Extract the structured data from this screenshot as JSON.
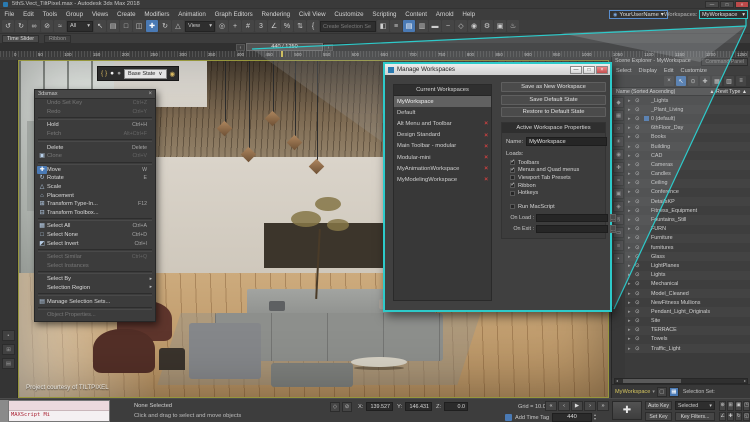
{
  "window": {
    "title": "5thS.Vect_TiltPixel.max  - Autodesk 3ds Max 2018",
    "minimize_glyph": "—",
    "maximize_glyph": "□",
    "close_glyph": "×"
  },
  "menubar": {
    "items": [
      "File",
      "Edit",
      "Tools",
      "Group",
      "Views",
      "Create",
      "Modifiers",
      "Animation",
      "Graph Editors",
      "Rendering",
      "Civil View",
      "Customize",
      "Scripting",
      "Content",
      "Arnold",
      "Help"
    ],
    "username": "YourUserName",
    "username_arrow": "▾",
    "workspaces_label": "Workspaces:",
    "workspace_value": "MyWorkspace",
    "workspace_arrow": "▾"
  },
  "toolbar": {
    "group1": [
      {
        "name": "undo-icon",
        "glyph": "↺"
      },
      {
        "name": "redo-icon",
        "glyph": "↻"
      },
      {
        "name": "select-link-icon",
        "glyph": "∞"
      },
      {
        "name": "unlink-icon",
        "glyph": "⊘"
      },
      {
        "name": "bind-spacewarp-icon",
        "glyph": "≈"
      }
    ],
    "filter_dropdown": "All",
    "group2": [
      {
        "name": "select-object-icon",
        "glyph": "↖"
      },
      {
        "name": "select-by-name-icon",
        "glyph": "▤"
      },
      {
        "name": "selection-region-icon",
        "glyph": "□"
      },
      {
        "name": "window-crossing-icon",
        "glyph": "◫"
      },
      {
        "name": "move-icon",
        "glyph": "✚",
        "active": true
      },
      {
        "name": "rotate-icon",
        "glyph": "↻"
      },
      {
        "name": "scale-icon",
        "glyph": "△"
      }
    ],
    "coord_dropdown": "View",
    "group3": [
      {
        "name": "pivot-center-icon",
        "glyph": "◎"
      },
      {
        "name": "select-manipulate-icon",
        "glyph": "+"
      },
      {
        "name": "keyboard-override-icon",
        "glyph": "#"
      },
      {
        "name": "snaps-toggle-icon",
        "glyph": "3"
      },
      {
        "name": "angle-snap-icon",
        "glyph": "∠"
      },
      {
        "name": "percent-snap-icon",
        "glyph": "%"
      },
      {
        "name": "spinner-snap-icon",
        "glyph": "⇅"
      },
      {
        "name": "edit-named-selections-icon",
        "glyph": "{"
      }
    ],
    "create_selection_label": "Create Selection Se",
    "group4": [
      {
        "name": "mirror-icon",
        "glyph": "◧"
      },
      {
        "name": "layer-manager-icon",
        "glyph": "≡"
      },
      {
        "name": "scene-explorer-toggle-icon",
        "glyph": "▤",
        "active": true
      },
      {
        "name": "layer-explorer-icon",
        "glyph": "▥"
      },
      {
        "name": "ribbon-toggle-icon",
        "glyph": "▬"
      },
      {
        "name": "curve-editor-icon",
        "glyph": "~"
      },
      {
        "name": "schematic-view-icon",
        "glyph": "◇"
      },
      {
        "name": "material-editor-icon",
        "glyph": "◉"
      },
      {
        "name": "render-setup-icon",
        "glyph": "⚙"
      },
      {
        "name": "rendered-frame-icon",
        "glyph": "▣"
      },
      {
        "name": "render-production-icon",
        "glyph": "♨"
      }
    ],
    "dropdown_arrow": "▾"
  },
  "timeline": {
    "tab_time_slider": "Time Slider",
    "tab_ribbon": "Ribbon",
    "frame_display": "440 / 1250",
    "prev_arrow": "‹",
    "next_arrow": "›",
    "ruler_labels": [
      "0",
      "50",
      "100",
      "150",
      "200",
      "250",
      "300",
      "350",
      "400",
      "450",
      "500",
      "550",
      "600",
      "650",
      "700",
      "750",
      "800",
      "850",
      "900",
      "950",
      "1000",
      "1050",
      "1100",
      "1150",
      "1200",
      "1250"
    ]
  },
  "viewport": {
    "watermark": "Project courtesy of TILTPIXEL",
    "state_toolbar": {
      "brace_glyph": "{ }",
      "sphere_a_glyph": "●",
      "sphere_b_glyph": "●",
      "dropdown_value": "Base State",
      "dropdown_arrow": "∨",
      "camera_glyph": "◉"
    }
  },
  "quad_menu": {
    "title": "3dsmax",
    "close_glyph": "×",
    "items": [
      {
        "label": "Undo Set Key",
        "shortcut": "Ctrl+Z",
        "disabled": true
      },
      {
        "label": "Redo",
        "shortcut": "Ctrl+Y",
        "disabled": true
      },
      {
        "sep": true
      },
      {
        "label": "Hold",
        "shortcut": "Ctrl+H"
      },
      {
        "label": "Fetch",
        "shortcut": "Alt+Ctrl+F",
        "disabled": true
      },
      {
        "sep": true
      },
      {
        "label": "Delete",
        "shortcut": "Delete"
      },
      {
        "label": "Clone",
        "shortcut": "Ctrl+V",
        "disabled": true,
        "icon": "▣"
      },
      {
        "sep": true
      },
      {
        "label": "Move",
        "shortcut": "W",
        "icon": "✚",
        "icon_active": true
      },
      {
        "label": "Rotate",
        "shortcut": "E",
        "icon": "↻"
      },
      {
        "label": "Scale",
        "icon": "△"
      },
      {
        "label": "Placement",
        "icon": "⌂"
      },
      {
        "label": "Transform Type-In...",
        "shortcut": "F12",
        "icon": "⊞"
      },
      {
        "label": "Transform Toolbox...",
        "icon": "⊟"
      },
      {
        "sep": true
      },
      {
        "label": "Select All",
        "shortcut": "Ctrl+A",
        "icon": "▦"
      },
      {
        "label": "Select None",
        "shortcut": "Ctrl+D",
        "icon": "□"
      },
      {
        "label": "Select Invert",
        "shortcut": "Ctrl+I",
        "icon": "◩"
      },
      {
        "sep": true
      },
      {
        "label": "Select Similar",
        "shortcut": "Ctrl+Q",
        "disabled": true
      },
      {
        "label": "Select Instances",
        "disabled": true
      },
      {
        "sep": true
      },
      {
        "label": "Select By",
        "submenu": true
      },
      {
        "label": "Selection Region",
        "submenu": true
      },
      {
        "sep": true
      },
      {
        "label": "Manage Selection Sets...",
        "icon": "▤"
      },
      {
        "sep": true
      },
      {
        "label": "Object Properties...",
        "disabled": true
      }
    ]
  },
  "dialog": {
    "title": "Manage Workspaces",
    "minimize_glyph": "—",
    "maximize_glyph": "□",
    "close_glyph": "×",
    "list_header": "Current Workspaces",
    "delete_glyph": "×",
    "workspaces": [
      {
        "label": "MyWorkspace",
        "selected": true
      },
      {
        "label": "Default"
      },
      {
        "label": "Alt Menu and Toolbar",
        "deletable": true
      },
      {
        "label": "Design Standard",
        "deletable": true
      },
      {
        "label": "Main Toolbar - modular",
        "deletable": true
      },
      {
        "label": "Modular-mini",
        "deletable": true
      },
      {
        "label": "MyAnimationWorkspace",
        "deletable": true
      },
      {
        "label": "MyModelingWorkspace",
        "deletable": true
      }
    ],
    "buttons": [
      "Save as New Workspace",
      "Save Default State",
      "Restore to Default State"
    ],
    "properties_header": "Active Workspace Properties",
    "name_label": "Name:",
    "name_value": "MyWorkspace",
    "loads_label": "Loads:",
    "load_options": [
      {
        "label": "Toolbars",
        "checked": true
      },
      {
        "label": "Menus and Quad menus",
        "checked": true
      },
      {
        "label": "Viewport Tab Presets"
      },
      {
        "label": "Ribbon",
        "checked": true
      },
      {
        "label": "Hotkeys"
      }
    ],
    "macro_label": "Run MacScript",
    "on_load_label": "On Load :",
    "on_exit_label": "On Exit :",
    "browse_button": "..."
  },
  "scene_explorer": {
    "title": "Scene Explorer - MyWorkspace",
    "command_panel_tab": "Command Panel",
    "menus": [
      "Select",
      "Display",
      "Edit",
      "Customize"
    ],
    "toolbar_icons": [
      {
        "name": "delete-icon",
        "glyph": "×"
      },
      {
        "name": "pick-icon",
        "glyph": "↖",
        "active": true
      },
      {
        "name": "lock-icon",
        "glyph": "⊙"
      },
      {
        "name": "add-icon",
        "glyph": "✚"
      },
      {
        "name": "properties-icon",
        "glyph": "▦"
      },
      {
        "name": "columns-icon",
        "glyph": "▥"
      },
      {
        "name": "settings-icon",
        "glyph": "≡"
      }
    ],
    "name_header": "Name (Sorted Ascending)",
    "sort_glyph": "▲",
    "type_header": "▲ Revit Type ▲",
    "arrow_glyph": "▸",
    "eye_glyph": "⊙",
    "side_icons": [
      {
        "name": "display-all-icon",
        "glyph": "◆"
      },
      {
        "name": "geometry-icon",
        "glyph": "▦"
      },
      {
        "name": "shapes-icon",
        "glyph": "○"
      },
      {
        "name": "lights-icon",
        "glyph": "☀"
      },
      {
        "name": "cameras-icon",
        "glyph": "◉"
      },
      {
        "name": "helpers-icon",
        "glyph": "✚"
      },
      {
        "name": "spacewarps-icon",
        "glyph": "≈"
      },
      {
        "name": "groups-icon",
        "glyph": "▣"
      },
      {
        "name": "xref-icon",
        "glyph": "◈"
      },
      {
        "name": "bones-icon",
        "glyph": "§"
      },
      {
        "name": "containers-icon",
        "glyph": "▭"
      },
      {
        "name": "materials-icon",
        "glyph": "≡"
      },
      {
        "name": "filter-icon",
        "glyph": "▪"
      }
    ],
    "rows": [
      {
        "label": "_Lights"
      },
      {
        "label": "_Plant_Living"
      },
      {
        "label": "0 (default)",
        "tag": true
      },
      {
        "label": "6thFloor_Day"
      },
      {
        "label": "Books"
      },
      {
        "label": "Building"
      },
      {
        "label": "CAD"
      },
      {
        "label": "Cameras"
      },
      {
        "label": "Candles"
      },
      {
        "label": "Ceiling"
      },
      {
        "label": "Conference"
      },
      {
        "label": "DetailsKP"
      },
      {
        "label": "Fitness_Equipment"
      },
      {
        "label": "Fountains_Still"
      },
      {
        "label": "FURN"
      },
      {
        "label": "Furniture"
      },
      {
        "label": "furnitures"
      },
      {
        "label": "Glass"
      },
      {
        "label": "LightPlanes"
      },
      {
        "label": "Lights"
      },
      {
        "label": "Mechanical"
      },
      {
        "label": "Model_Cleaned"
      },
      {
        "label": "NewFitness Mullions"
      },
      {
        "label": "Pendant_Light_Originals"
      },
      {
        "label": "Site"
      },
      {
        "label": "TERRACE"
      },
      {
        "label": "Towels"
      },
      {
        "label": "Traffic_Light"
      }
    ],
    "workspace_selector": "MyWorkspace",
    "workspace_selector_arrow": "▾",
    "selection_set_label": "Selection Set:"
  },
  "statusbar": {
    "maxscript_label": "MAXScript Mi",
    "status_line": "None Selected",
    "prompt_line": "Click and drag to select and move objects",
    "isolate_glyph": "◇",
    "lock_glyph": "⊘",
    "x_label": "X:",
    "x_value": "139.527",
    "y_label": "Y:",
    "y_value": "146.431",
    "z_label": "Z:",
    "z_value": "0.0",
    "grid_label": "Grid = 10.0",
    "time_tag_label": "Add Time Tag",
    "frame_value": "440",
    "spinner_up": "▴",
    "spinner_down": "▾",
    "big_key_glyph": "✚",
    "auto_key": "Auto Key",
    "set_key": "Set Key",
    "selected_dropdown": "Selected",
    "selected_arrow": "▾",
    "key_filters": "Key Filters...",
    "playback": [
      {
        "name": "go-to-start-button",
        "glyph": "«"
      },
      {
        "name": "previous-frame-button",
        "glyph": "‹"
      },
      {
        "name": "play-button",
        "glyph": "▶"
      },
      {
        "name": "next-frame-button",
        "glyph": "›"
      },
      {
        "name": "go-to-end-button",
        "glyph": "»"
      }
    ],
    "nav_icons": [
      {
        "name": "zoom-icon",
        "glyph": "⊕"
      },
      {
        "name": "zoom-all-icon",
        "glyph": "⊞"
      },
      {
        "name": "zoom-extents-icon",
        "glyph": "▣"
      },
      {
        "name": "zoom-extents-all-icon",
        "glyph": "◳"
      },
      {
        "name": "fov-icon",
        "glyph": "∠"
      },
      {
        "name": "pan-icon",
        "glyph": "✚"
      },
      {
        "name": "orbit-icon",
        "glyph": "↻"
      },
      {
        "name": "maximize-viewport-icon",
        "glyph": "◱"
      }
    ]
  },
  "colors": {
    "accent_cyan": "#2dcaca",
    "highlight_blue": "#4a7ab5",
    "close_red": "#bc4a4a",
    "delete_red": "#d04040",
    "workspace_yellow": "#d8c860",
    "viewport_border": "#96963c"
  }
}
